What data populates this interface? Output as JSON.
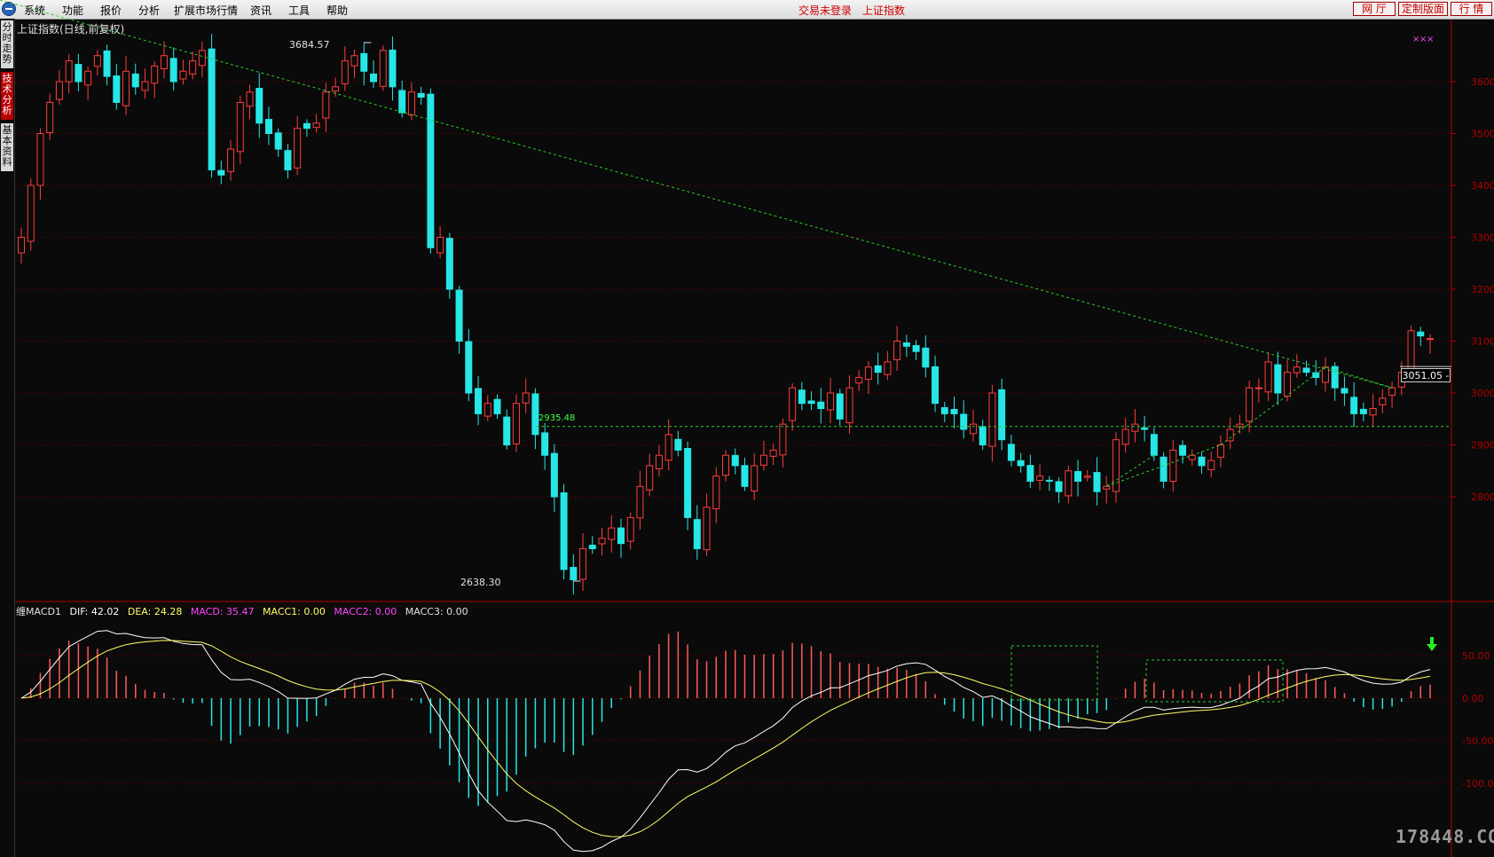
{
  "menubar": {
    "items": [
      "系统",
      "功能",
      "报价",
      "分析",
      "扩展市场行情",
      "资讯",
      "工具",
      "帮助"
    ],
    "status_not_logged": "交易未登录",
    "status_index": "上证指数",
    "right_buttons": [
      "网 厅",
      "定制版面",
      "行 情"
    ]
  },
  "sidebar_tabs": [
    {
      "label": "分时走势",
      "active": false
    },
    {
      "label": "技术分析",
      "active": true
    },
    {
      "label": "基本资料",
      "active": false
    }
  ],
  "price_chart": {
    "title": "上证指数(日线,前复权)",
    "high_label": "3684.57",
    "low_label": "2638.30",
    "ref_label": "2935.48",
    "current_label": "3051.05 -",
    "y_ticks": [
      "3600",
      "3500",
      "3400",
      "3300",
      "3200",
      "3100",
      "3000",
      "2900",
      "2800"
    ]
  },
  "macd_chart": {
    "legend": {
      "name": "缠MACD1",
      "dif": "DIF: 42.02",
      "dea": "DEA: 24.28",
      "macd": "MACD: 35.47",
      "macc1": "MACC1: 0.00",
      "macc2": "MACC2: 0.00",
      "macc3": "MACC3: 0.00"
    },
    "y_ticks": [
      "50.00",
      "0.00",
      "-50.00",
      "-100.00"
    ]
  },
  "chart_data": [
    {
      "type": "candlestick",
      "title": "上证指数(日线,前复权)",
      "y_ticks": [
        3600,
        3500,
        3400,
        3300,
        3200,
        3100,
        3000,
        2900,
        2800
      ],
      "annotations": {
        "high": 3684.57,
        "low": 2638.3,
        "reference_level": 2935.48,
        "current": 3051.05
      },
      "close_series": [
        3300,
        3400,
        3500,
        3560,
        3600,
        3640,
        3600,
        3620,
        3650,
        3610,
        3560,
        3620,
        3590,
        3600,
        3630,
        3650,
        3600,
        3620,
        3640,
        3660,
        3430,
        3420,
        3470,
        3560,
        3580,
        3520,
        3500,
        3470,
        3430,
        3510,
        3510,
        3520,
        3580,
        3590,
        3640,
        3650,
        3620,
        3600,
        3660,
        3590,
        3540,
        3580,
        3570,
        3280,
        3300,
        3200,
        3100,
        3000,
        2960,
        2980,
        2960,
        2900,
        2980,
        3000,
        2920,
        2880,
        2800,
        2660,
        2640,
        2700,
        2700,
        2720,
        2740,
        2710,
        2760,
        2820,
        2860,
        2880,
        2920,
        2890,
        2760,
        2700,
        2780,
        2840,
        2880,
        2860,
        2820,
        2860,
        2880,
        2890,
        2940,
        3010,
        2980,
        2980,
        2970,
        3000,
        2950,
        3010,
        3030,
        3050,
        3040,
        3060,
        3100,
        3090,
        3080,
        3050,
        2980,
        2960,
        2960,
        2930,
        2940,
        2900,
        3000,
        2910,
        2870,
        2860,
        2830,
        2840,
        2830,
        2810,
        2850,
        2830,
        2840,
        2810,
        2820,
        2910,
        2930,
        2940,
        2930,
        2880,
        2830,
        2890,
        2880,
        2880,
        2860,
        2870,
        2900,
        2930,
        2940,
        3010,
        3010,
        3060,
        3000,
        3040,
        3050,
        3040,
        3030,
        3050,
        3010,
        3000,
        2960,
        2960,
        2970,
        2990,
        3010,
        3040,
        3120,
        3110,
        3105
      ]
    },
    {
      "type": "line+bar",
      "title": "缠MACD1",
      "series": [
        {
          "name": "DIF",
          "value_last": 42.02
        },
        {
          "name": "DEA",
          "value_last": 24.28
        },
        {
          "name": "MACD",
          "value_last": 35.47
        }
      ],
      "y_ticks": [
        50,
        0,
        -50,
        -100
      ]
    }
  ]
}
